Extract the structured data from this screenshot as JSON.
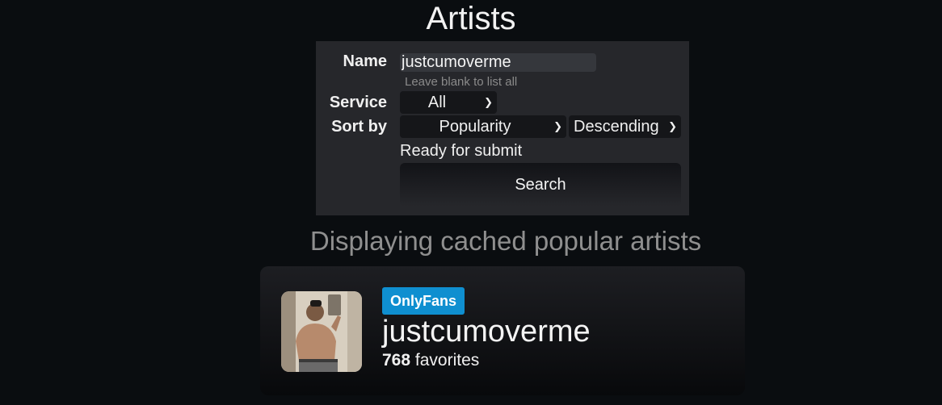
{
  "page": {
    "title": "Artists"
  },
  "form": {
    "name_label": "Name",
    "name_value": "justcumoverme",
    "name_hint": "Leave blank to list all",
    "service_label": "Service",
    "service_value": "All",
    "sort_label": "Sort by",
    "sort_value": "Popularity",
    "order_value": "Descending",
    "status": "Ready for submit",
    "search_button": "Search"
  },
  "results": {
    "heading": "Displaying cached popular artists",
    "artists": [
      {
        "service": "OnlyFans",
        "name": "justcumoverme",
        "favorites_count": "768",
        "favorites_label": "favorites"
      }
    ]
  },
  "colors": {
    "background": "#0a0d10",
    "form_bg": "#26272b",
    "badge_onlyfans": "#0f8fd0"
  },
  "icons": {
    "select_chevron": "chevron-down-icon"
  }
}
